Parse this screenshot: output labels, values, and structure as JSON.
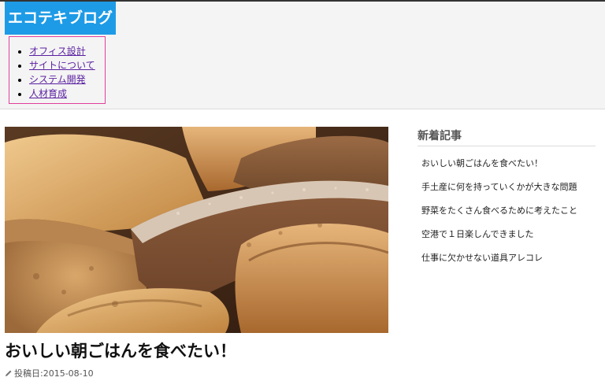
{
  "site": {
    "title": "エコテキブログ"
  },
  "nav": {
    "items": [
      {
        "label": "オフィス設計"
      },
      {
        "label": "サイトについて"
      },
      {
        "label": "システム開発"
      },
      {
        "label": "人材育成"
      }
    ]
  },
  "article": {
    "image_alt": "bread",
    "title": "おいしい朝ごはんを食べたい！",
    "meta_icon": "pencil-icon",
    "date": "投稿日:2015-08-10"
  },
  "sidebar": {
    "heading": "新着記事",
    "items": [
      {
        "label": "おいしい朝ごはんを食べたい！"
      },
      {
        "label": "手土産に何を持っていくかが大きな問題"
      },
      {
        "label": "野菜をたくさん食べるために考えたこと"
      },
      {
        "label": "空港で１日楽しんできました"
      },
      {
        "label": "仕事に欠かせない道具アレコレ"
      }
    ]
  },
  "colors": {
    "logo_bg": "#1e9be6",
    "nav_border": "#e0409a",
    "link": "#5a1fa0"
  }
}
